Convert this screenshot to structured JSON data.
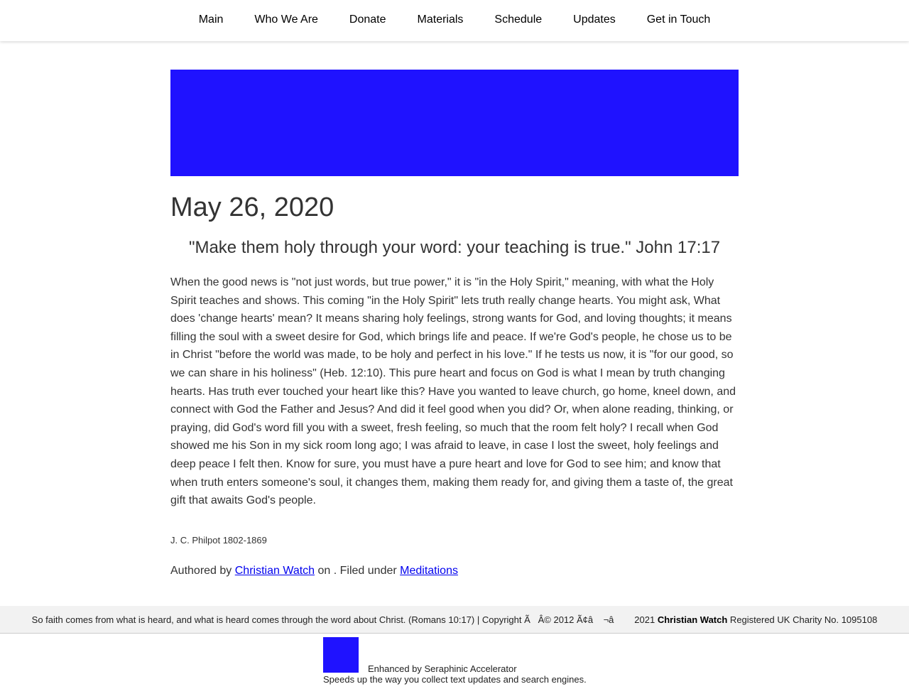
{
  "colors": {
    "accent": "#1f12ff",
    "link": "#0000ee",
    "text": "#333333"
  },
  "nav": {
    "items": [
      {
        "label": "Main"
      },
      {
        "label": "Who We Are"
      },
      {
        "label": "Donate"
      },
      {
        "label": "Materials"
      },
      {
        "label": "Schedule"
      },
      {
        "label": "Updates"
      },
      {
        "label": "Get in Touch"
      }
    ]
  },
  "post": {
    "date": "May 26, 2020",
    "verse": "\"Make them holy through your word: your teaching is true.\" John 17:17",
    "body": "When the good news is \"not just words, but true power,\" it is \"in the Holy Spirit,\" meaning, with what the Holy Spirit teaches and shows. This coming \"in the Holy Spirit\" lets truth really change hearts. You might ask, What does 'change hearts' mean? It means sharing holy feelings, strong wants for God, and loving thoughts; it means filling the soul with a sweet desire for God, which brings life and peace. If we're God's people, he chose us to be in Christ \"before the world was made, to be holy and perfect in his love.\" If he tests us now, it is \"for our good, so we can share in his holiness\" (Heb. 12:10). This pure heart and focus on God is what I mean by truth changing hearts. Has truth ever touched your heart like this? Have you wanted to leave church, go home, kneel down, and connect with God the Father and Jesus? And did it feel good when you did? Or, when alone reading, thinking, or praying, did God's word fill you with a sweet, fresh feeling, so much that the room felt holy? I recall when God showed me his Son in my sick room long ago; I was afraid to leave, in case I lost the sweet, holy feelings and deep peace I felt then. Know for sure, you must have a pure heart and love for God to see him; and know that when truth enters someone's soul, it changes them, making them ready for, and giving them a taste of, the great gift that awaits God's people.",
    "attribution": "J. C. Philpot 1802-1869",
    "meta": {
      "authored_by": "Authored by ",
      "author": "Christian Watch",
      "on_text": " on . Filed under ",
      "category": "Meditations"
    }
  },
  "footer": {
    "text": "So faith comes from what is heard, and what is heard comes through the word about Christ. (Romans 10:17) | Copyright Ã   Â© 2012 Ã¢â    ¬â        2021 ",
    "org": "Christian Watch",
    "charity": " Registered UK Charity No. 1095108"
  },
  "badge": {
    "title": "Enhanced by Seraphinic Accelerator",
    "description": "Speeds up the way you collect text updates and search engines."
  }
}
